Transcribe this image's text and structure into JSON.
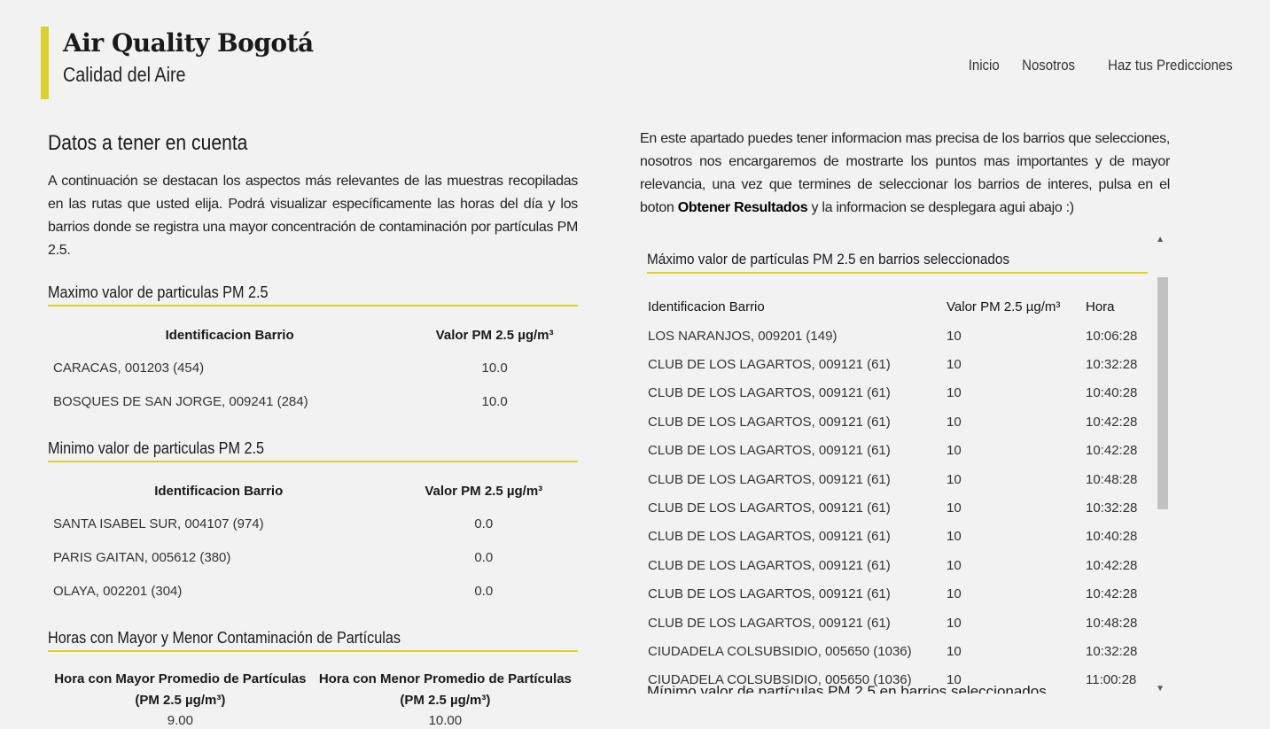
{
  "brand": {
    "title": "Air Quality Bogotá",
    "subtitle": "Calidad del Aire"
  },
  "nav": [
    "Inicio",
    "Nosotros",
    "Haz tus Predicciones"
  ],
  "left": {
    "heading": "Datos a tener en cuenta",
    "intro": "A continuación se destacan los aspectos más relevantes de las muestras recopiladas en las rutas que usted elija. Podrá visualizar específicamente las horas del día y los barrios donde se registra una mayor concentración de contaminación por partículas PM 2.5.",
    "max": {
      "title": "Maximo valor de particulas PM 2.5",
      "headers": [
        "Identificacion Barrio",
        "Valor PM 2.5 µg/m³"
      ],
      "rows": [
        [
          "CARACAS, 001203 (454)",
          "10.0"
        ],
        [
          "BOSQUES DE SAN JORGE, 009241 (284)",
          "10.0"
        ]
      ]
    },
    "min": {
      "title": "Minimo valor de particulas PM 2.5",
      "headers": [
        "Identificacion Barrio",
        "Valor PM 2.5 µg/m³"
      ],
      "rows": [
        [
          "SANTA ISABEL SUR, 004107 (974)",
          "0.0"
        ],
        [
          "PARIS GAITAN, 005612 (380)",
          "0.0"
        ],
        [
          "OLAYA, 002201 (304)",
          "0.0"
        ]
      ]
    },
    "hours": {
      "title": "Horas con Mayor y Menor Contaminación de Partículas",
      "headers": [
        "Hora con Mayor Promedio de Partículas (PM 2.5 µg/m³)",
        "Hora con Menor Promedio de Partículas (PM 2.5 µg/m³)"
      ],
      "values": [
        "9.00",
        "10.00"
      ]
    }
  },
  "right": {
    "text_before": "En este apartado puedes tener informacion mas precisa de los barrios que selecciones, nosotros nos encargaremos de mostrarte los puntos mas importantes y de mayor relevancia, una vez que termines de seleccionar los barrios de interes, pulsa en el boton",
    "text_bold": "Obtener Resultados",
    "text_after": "y la informacion se desplegara agui abajo :)",
    "max_title": "Máximo valor de partículas PM 2.5 en barrios seleccionados",
    "headers": [
      "Identificacion Barrio",
      "Valor PM 2.5 µg/m³",
      "Hora"
    ],
    "rows": [
      [
        "LOS NARANJOS, 009201 (149)",
        "10",
        "10:06:28"
      ],
      [
        "CLUB DE LOS LAGARTOS, 009121 (61)",
        "10",
        "10:32:28"
      ],
      [
        "CLUB DE LOS LAGARTOS, 009121 (61)",
        "10",
        "10:40:28"
      ],
      [
        "CLUB DE LOS LAGARTOS, 009121 (61)",
        "10",
        "10:42:28"
      ],
      [
        "CLUB DE LOS LAGARTOS, 009121 (61)",
        "10",
        "10:42:28"
      ],
      [
        "CLUB DE LOS LAGARTOS, 009121 (61)",
        "10",
        "10:48:28"
      ],
      [
        "CLUB DE LOS LAGARTOS, 009121 (61)",
        "10",
        "10:32:28"
      ],
      [
        "CLUB DE LOS LAGARTOS, 009121 (61)",
        "10",
        "10:40:28"
      ],
      [
        "CLUB DE LOS LAGARTOS, 009121 (61)",
        "10",
        "10:42:28"
      ],
      [
        "CLUB DE LOS LAGARTOS, 009121 (61)",
        "10",
        "10:42:28"
      ],
      [
        "CLUB DE LOS LAGARTOS, 009121 (61)",
        "10",
        "10:48:28"
      ],
      [
        "CIUDADELA COLSUBSIDIO, 005650 (1036)",
        "10",
        "10:32:28"
      ],
      [
        "CIUDADELA COLSUBSIDIO, 005650 (1036)",
        "10",
        "11:00:28"
      ]
    ],
    "min_title": "Mínimo valor de partículas PM 2.5 en barrios seleccionados"
  },
  "colors": {
    "accent": "#d9d22e",
    "background": "#f2f2f2",
    "scroll_thumb": "#c1c1c1"
  }
}
